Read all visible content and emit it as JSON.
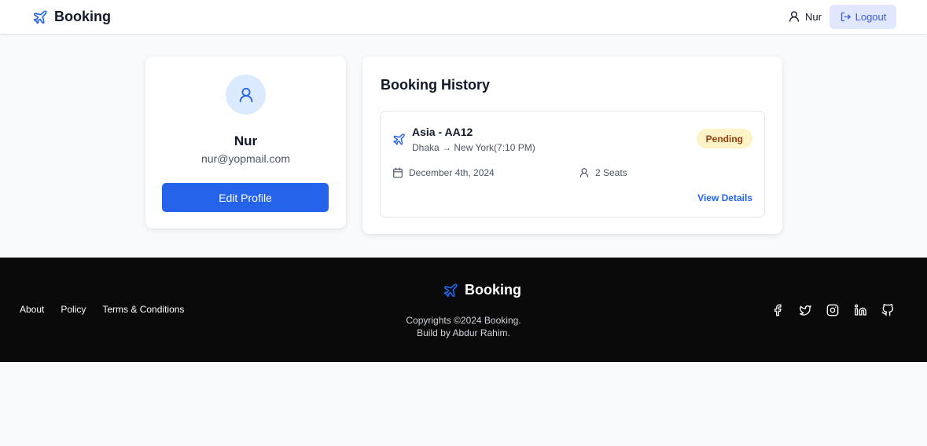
{
  "header": {
    "brand": "Booking",
    "user_name": "Nur",
    "logout_label": "Logout"
  },
  "profile": {
    "name": "Nur",
    "email": "nur@yopmail.com",
    "edit_label": "Edit Profile"
  },
  "history": {
    "title": "Booking History",
    "items": [
      {
        "flight": "Asia - AA12",
        "route": "Dhaka → New York(7:10 PM)",
        "status": "Pending",
        "date": "December 4th, 2024",
        "seats": "2 Seats",
        "details_label": "View Details"
      }
    ]
  },
  "footer": {
    "links": [
      "About",
      "Policy",
      "Terms & Conditions"
    ],
    "brand": "Booking",
    "copyright": "Copyrights ©2024 Booking.",
    "credit": "Build by Abdur Rahim.",
    "socials": [
      "facebook-icon",
      "twitter-icon",
      "instagram-icon",
      "linkedin-icon",
      "github-icon"
    ]
  },
  "colors": {
    "primary": "#2563eb",
    "pending_bg": "#fef3c7",
    "pending_text": "#92400e",
    "footer_bg": "#0a0a0a"
  }
}
